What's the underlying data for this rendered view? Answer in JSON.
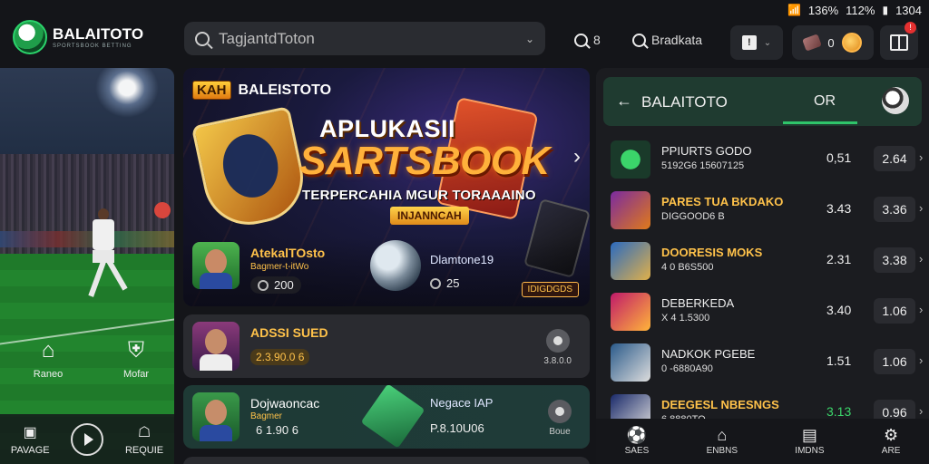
{
  "status_bar": {
    "signal_icon": "wifi-icon",
    "battery1": "136%",
    "battery2": "112%",
    "time": "1304"
  },
  "topbar": {
    "logo_name": "BALAITOTO",
    "logo_sub": "SPORTSBOOK BETTING",
    "search_placeholder": "TagjantdToton",
    "search_short": "8",
    "search2_label": "Bradkata",
    "coins_count": "0"
  },
  "left_panel": {
    "nav": [
      {
        "icon": "home-icon",
        "label": "Raneo"
      },
      {
        "icon": "shield-icon",
        "label": "Mofar"
      }
    ],
    "bottom": [
      {
        "icon": "tv-icon",
        "label": "PAVAGE"
      },
      {
        "icon": "play-icon",
        "label": ""
      },
      {
        "icon": "bag-icon",
        "label": "REQUIE"
      }
    ]
  },
  "banner": {
    "badge": "KAH",
    "brand": "BALEISTOTO",
    "title_line1": "APLUKASII",
    "title_line2": "SARTSBOOK",
    "subtitle": "TERPERCAHIA MGUR TORAAAINO",
    "pill": "INJANNCAH",
    "player_name": "AtekalTOsto",
    "player_sub": "Bagmer-t-itWo",
    "player_stat": "200",
    "label2": "Dlamtone19",
    "stat2": "25",
    "cta": "IDIGDGDS"
  },
  "cards": [
    {
      "title": "ADSSI SUED",
      "sub": "",
      "value": "2.3.90.0 6",
      "right_label": "3.8.0.0"
    },
    {
      "title": "Dojwaoncac",
      "sub": "Bagmer",
      "value": "6 1.90 6",
      "mid_title": "Negace IAP",
      "mid_value": "P.8.10U06",
      "right_label": "Boue"
    }
  ],
  "right_panel": {
    "title": "BALAITOTO",
    "tab": "OR",
    "rows": [
      {
        "name": "PPIURTS GODO",
        "sub": "5192G6 15607125",
        "v1": "0,51",
        "v2": "2.64",
        "highlight": false,
        "green": false
      },
      {
        "name": "PARES TUA BKDAKO",
        "sub": "DIGGOOD6 B",
        "v1": "3.43",
        "v2": "3.36",
        "highlight": true,
        "green": false
      },
      {
        "name": "DOORESIS MOKS",
        "sub": "4 0 B6S500",
        "v1": "2.31",
        "v2": "3.38",
        "highlight": true,
        "green": false
      },
      {
        "name": "DEBERKEDA",
        "sub": "X 4 1.5300",
        "v1": "3.40",
        "v2": "1.06",
        "highlight": false,
        "green": false
      },
      {
        "name": "NADKOK PGEBE",
        "sub": "0 -6880A90",
        "v1": "1.51",
        "v2": "1.06",
        "highlight": false,
        "green": false
      },
      {
        "name": "DEEGESL NBESNGS",
        "sub": "6 8880TO",
        "v1": "3.13",
        "v2": "0.96",
        "highlight": true,
        "green": true
      }
    ],
    "bottom": [
      {
        "icon": "ball-icon",
        "label": "SAES"
      },
      {
        "icon": "home-icon",
        "label": "ENBNS"
      },
      {
        "icon": "list-icon",
        "label": "IMDNS"
      },
      {
        "icon": "gear-icon",
        "label": "ARE"
      }
    ]
  }
}
